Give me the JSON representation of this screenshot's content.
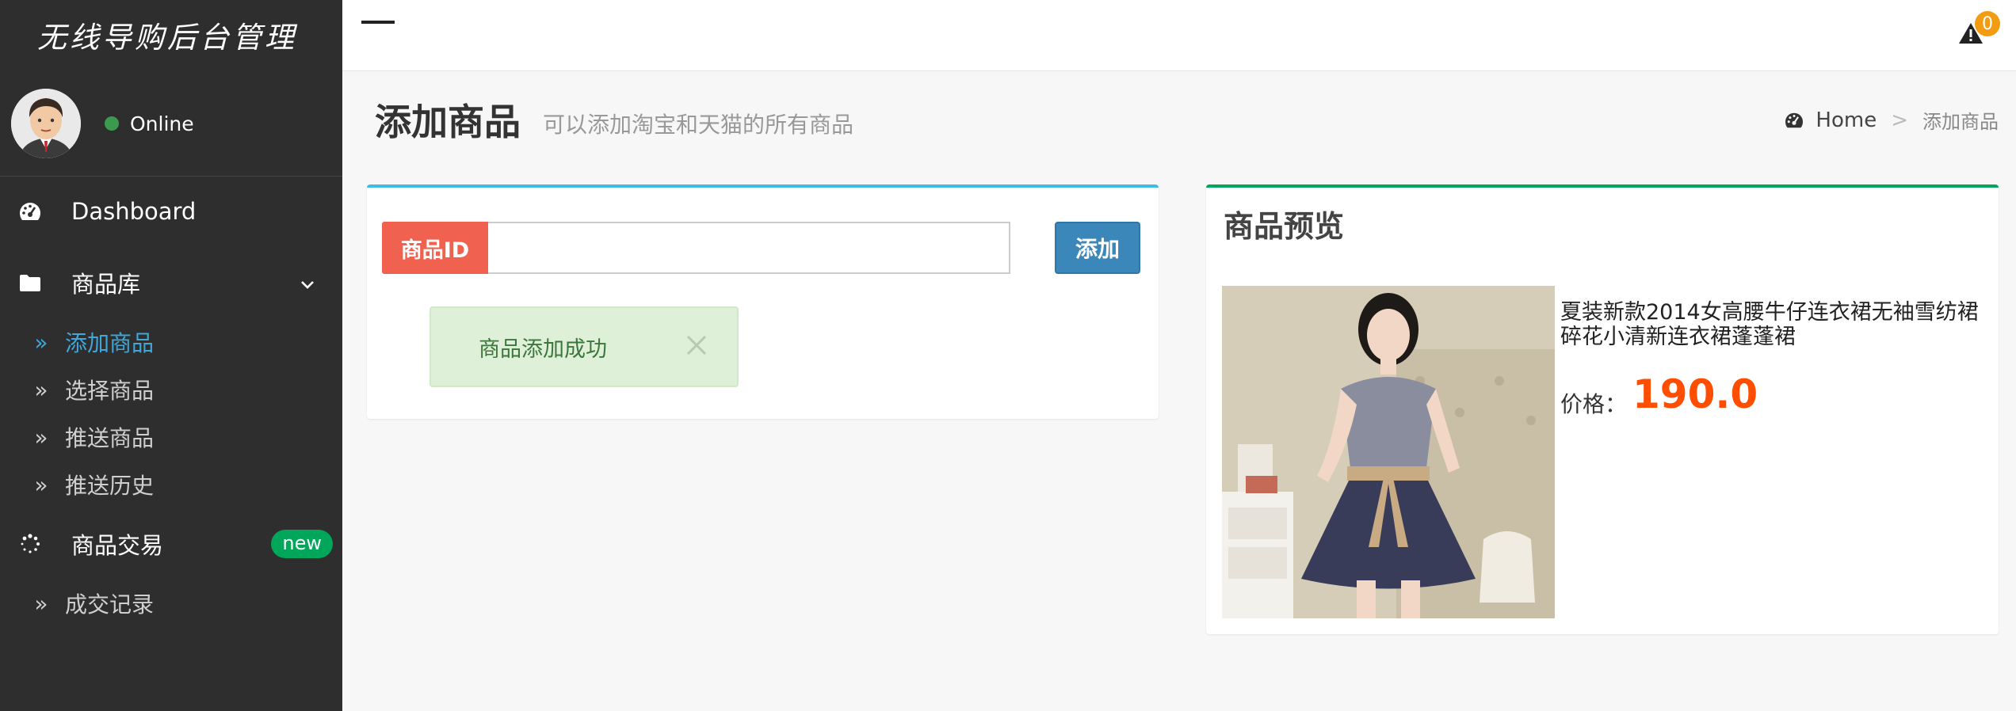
{
  "sidebar": {
    "brand": "无线导购后台管理",
    "user_status": "Online",
    "nav": [
      {
        "label": "Dashboard",
        "icon": "dashboard-icon"
      },
      {
        "label": "商品库",
        "icon": "folder-icon"
      },
      {
        "label": "商品交易",
        "icon": "spinner-icon",
        "badge": "new"
      }
    ],
    "submenu_products": [
      "添加商品",
      "选择商品",
      "推送商品",
      "推送历史"
    ],
    "submenu_trade": [
      "成交记录"
    ]
  },
  "header": {
    "alert_count": "0"
  },
  "page": {
    "title": "添加商品",
    "subtitle": "可以添加淘宝和天猫的所有商品",
    "breadcrumb": [
      "Home",
      ">",
      "添加商品"
    ]
  },
  "form": {
    "id_label": "商品ID",
    "id_value": "",
    "add_label": "添加",
    "success_message": "商品添加成功"
  },
  "preview": {
    "title": "商品预览",
    "product_name": "夏装新款2014女高腰牛仔连衣裙无袖雪纺裙碎花小清新连衣裙蓬蓬裙",
    "price_label": "价格：",
    "price_value": "190.0"
  },
  "colors": {
    "sidebar_bg": "#2e2e2e",
    "active_link": "#3fa7d9",
    "badge_new": "#00a65a",
    "addon_red": "#f0624f",
    "button_blue": "#3c87b9",
    "price_orange": "#ff4e00",
    "alert_orange": "#f39c12"
  }
}
